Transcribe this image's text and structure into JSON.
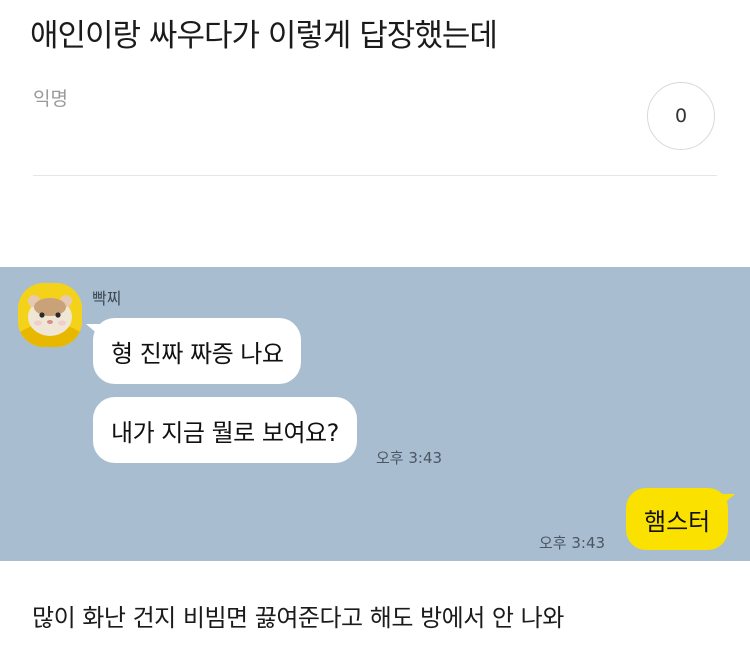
{
  "post": {
    "title": "애인이랑 싸우다가 이렇게 답장했는데",
    "author": "익명",
    "comment_count": "0",
    "body": "많이 화난 건지 비빔면 끓여준다고 해도 방에서 안 나와"
  },
  "chat": {
    "sender_name": "빡찌",
    "incoming_messages": [
      "형 진짜 짜증 나요",
      "내가 지금 뭘로 보여요?"
    ],
    "incoming_time": "오후 3:43",
    "outgoing_message": "햄스터",
    "outgoing_time": "오후 3:43",
    "colors": {
      "background": "#a9bdd1",
      "outgoing_bubble": "#fae100",
      "incoming_bubble": "#ffffff"
    }
  }
}
